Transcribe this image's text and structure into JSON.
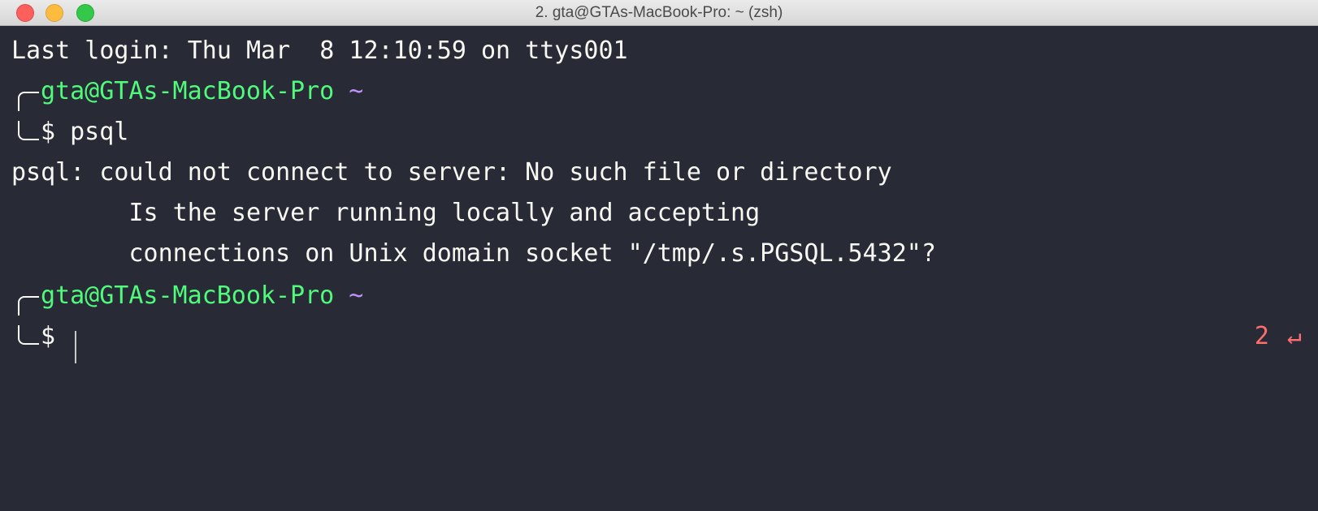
{
  "window": {
    "title": "2. gta@GTAs-MacBook-Pro: ~ (zsh)"
  },
  "terminal": {
    "last_login": "Last login: Thu Mar  8 12:10:59 on ttys001",
    "prompt_user_host": "gta@GTAs-MacBook-Pro",
    "prompt_dir": "~",
    "prompt_symbol": "$",
    "command": "psql",
    "error_lines": [
      "psql: could not connect to server: No such file or directory",
      "        Is the server running locally and accepting",
      "        connections on Unix domain socket \"/tmp/.s.PGSQL.5432\"?"
    ],
    "exit_code": "2",
    "return_icon": "↵"
  },
  "colors": {
    "background": "#282a36",
    "foreground": "#f8f8f2",
    "user_host": "#50fa7b",
    "directory": "#bd93f9",
    "error_code": "#ff6e6e"
  },
  "icons": [
    "close-button",
    "minimize-button",
    "zoom-button",
    "return-icon"
  ]
}
